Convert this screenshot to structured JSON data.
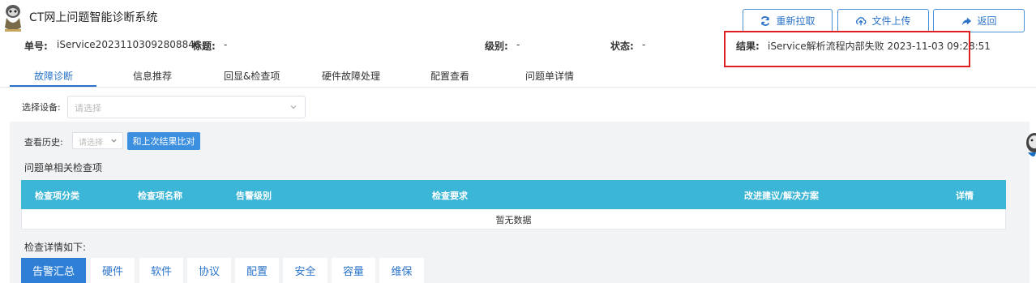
{
  "app": {
    "title": "CT网上问题智能诊断系统"
  },
  "toolbar": {
    "refetch_label": "重新拉取",
    "upload_label": "文件上传",
    "back_label": "返回"
  },
  "info": {
    "ticket_label": "单号:",
    "ticket_value": "iService20231103092808846",
    "title_label": "标题:",
    "title_value": "-",
    "level_label": "级别:",
    "level_value": "-",
    "status_label": "状态:",
    "status_value": "-",
    "result_label": "结果:",
    "result_value": "iService解析流程内部失败 2023-11-03 09:28:51"
  },
  "tabs": [
    "故障诊断",
    "信息推荐",
    "回显&检查项",
    "硬件故障处理",
    "配置查看",
    "问题单详情"
  ],
  "device": {
    "label": "选择设备:",
    "placeholder": "请选择"
  },
  "history": {
    "label": "查看历史:",
    "placeholder": "请选择",
    "compare_label": "和上次结果比对"
  },
  "checks": {
    "section_title": "问题单相关检查项",
    "columns": [
      "检查项分类",
      "检查项名称",
      "告警级别",
      "检查要求",
      "改进建议/解决方案",
      "详情"
    ],
    "empty_text": "暂无数据"
  },
  "details": {
    "title": "检查详情如下:",
    "tabs": [
      "告警汇总",
      "硬件",
      "软件",
      "协议",
      "配置",
      "安全",
      "容量",
      "维保"
    ]
  },
  "colors": {
    "accent": "#2a73c8",
    "table_header": "#3bb6d6",
    "highlight": "#e02020"
  }
}
